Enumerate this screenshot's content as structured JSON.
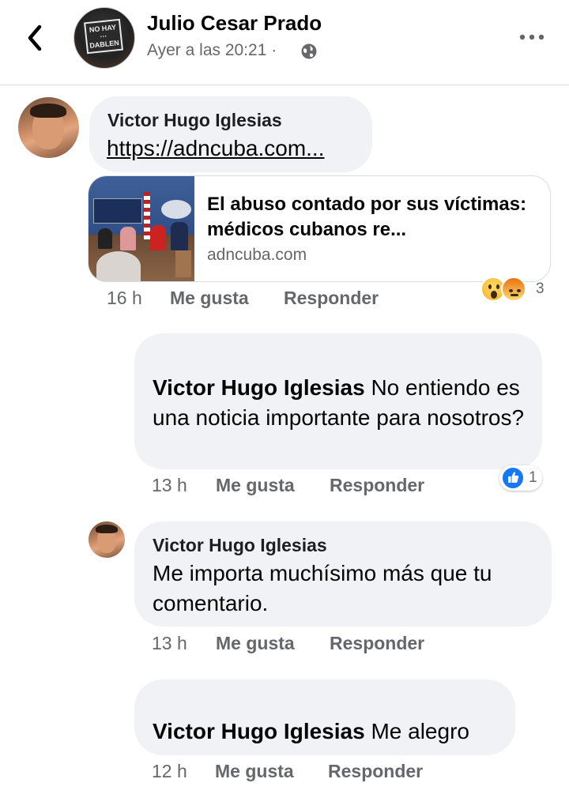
{
  "header": {
    "author": "Julio Cesar Prado",
    "timestamp": "Ayer a las 20:21",
    "separator": "·",
    "avatar_sign_text": "NO HAY ... DABLEN"
  },
  "comments": [
    {
      "name": "Victor Hugo Iglesias",
      "link_text": "https://adncuba.com...",
      "link_preview": {
        "title": "El abuso contado por sus víctimas: médicos cubanos re...",
        "domain": "adncuba.com"
      },
      "time": "16 h",
      "like_label": "Me gusta",
      "reply_label": "Responder",
      "reactions": [
        "wow",
        "angry"
      ],
      "reaction_count": "3"
    },
    {
      "name": "Victor Hugo Iglesias",
      "text": "No entiendo es una noticia importante para nosotros?",
      "time": "13 h",
      "like_label": "Me gusta",
      "reply_label": "Responder",
      "reactions": [
        "like"
      ],
      "reaction_count": "1"
    },
    {
      "name": "Victor Hugo Iglesias",
      "text": "Me importa muchísimo más que tu comentario.",
      "time": "13 h",
      "like_label": "Me gusta",
      "reply_label": "Responder"
    },
    {
      "name": "Victor Hugo Iglesias",
      "text": "Me alegro",
      "time": "12 h",
      "like_label": "Me gusta",
      "reply_label": "Responder"
    }
  ],
  "colors": {
    "bubble": "#f0f2f5",
    "secondary_text": "#65676b",
    "like_blue": "#1877f2"
  }
}
